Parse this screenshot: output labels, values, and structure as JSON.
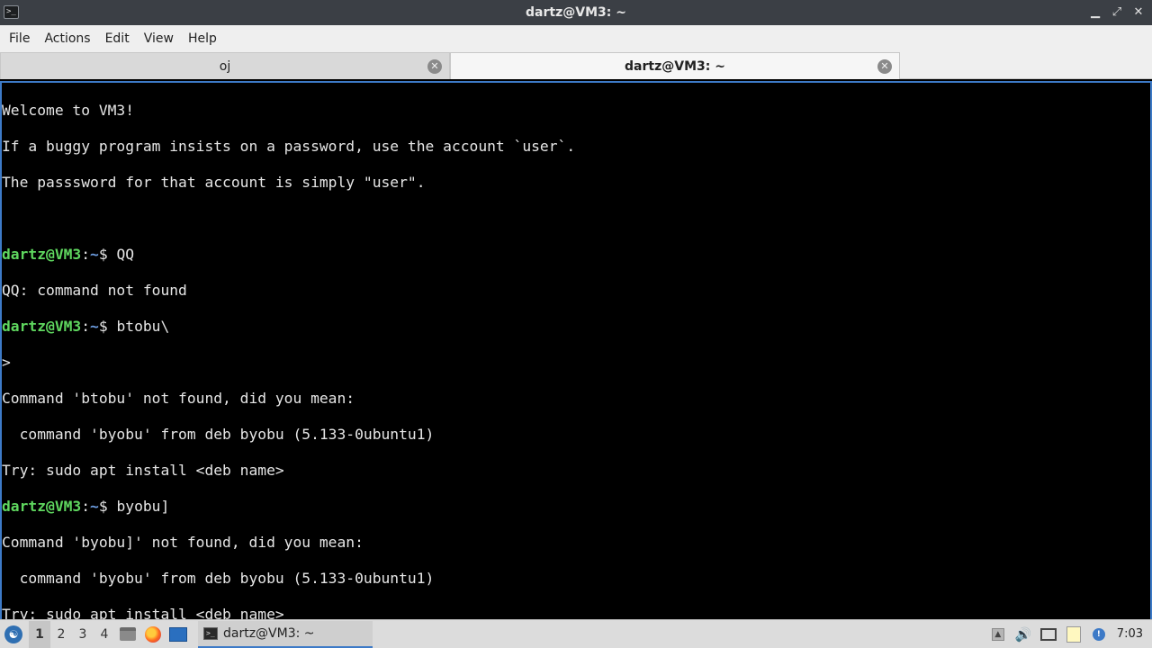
{
  "window": {
    "title": "dartz@VM3: ~",
    "minimize_glyph": "▁",
    "maximize_glyph": "⤢",
    "close_glyph": "✕",
    "app_icon_glyph": ">_"
  },
  "menu": {
    "file": "File",
    "actions": "Actions",
    "edit": "Edit",
    "view": "View",
    "help": "Help"
  },
  "tabs": [
    {
      "label": "oj",
      "active": false,
      "close_glyph": "✕"
    },
    {
      "label": "dartz@VM3: ~",
      "active": true,
      "close_glyph": "✕"
    }
  ],
  "terminal": {
    "prompt_user": "dartz@VM3",
    "prompt_sep": ":",
    "prompt_path": "~",
    "prompt_end": "$ ",
    "lines": {
      "l1": "Welcome to VM3!",
      "l2": "If a buggy program insists on a password, use the account `user`.",
      "l3": "The passsword for that account is simply \"user\".",
      "l4": "",
      "cmd1": "QQ",
      "l6": "QQ: command not found",
      "cmd2": "btobu\\",
      "l8": ">",
      "l9": "Command 'btobu' not found, did you mean:",
      "l10": "  command 'byobu' from deb byobu (5.133-0ubuntu1)",
      "l11": "Try: sudo apt install <deb name>",
      "cmd3": "byobu]",
      "l13": "Command 'byobu]' not found, did you mean:",
      "l14": "  command 'byobu' from deb byobu (5.133-0ubuntu1)",
      "l15": "Try: sudo apt install <deb name>"
    }
  },
  "taskbar": {
    "start_glyph": "☯",
    "desktops": [
      "1",
      "2",
      "3",
      "4"
    ],
    "active_desktop": "1",
    "task_label": "dartz@VM3: ~",
    "task_icon_glyph": ">_",
    "tray_up_glyph": "▲",
    "volume_glyph": "🔊",
    "notification_glyph": "!",
    "clock": "7:03"
  },
  "colors": {
    "prompt_user": "#5fd75f",
    "prompt_path": "#6c9ce0",
    "terminal_bg": "#000000",
    "terminal_fg": "#e6e6e6",
    "accent": "#3d7ac7"
  }
}
